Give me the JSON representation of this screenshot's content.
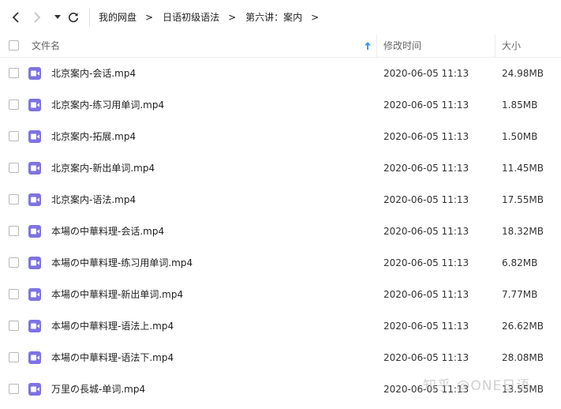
{
  "nav": {
    "breadcrumbs": [
      "我的网盘",
      "日语初级语法",
      "第六讲：案内"
    ],
    "separator": ">"
  },
  "header": {
    "col_name": "文件名",
    "col_date": "修改时间",
    "col_size": "大小",
    "sort_icon": "arrow-up-icon"
  },
  "files": [
    {
      "name": "北京案内-会话.mp4",
      "date": "2020-06-05 11:13",
      "size": "24.98MB"
    },
    {
      "name": "北京案内-练习用单词.mp4",
      "date": "2020-06-05 11:13",
      "size": "1.85MB"
    },
    {
      "name": "北京案内-拓展.mp4",
      "date": "2020-06-05 11:13",
      "size": "1.50MB"
    },
    {
      "name": "北京案内-新出单词.mp4",
      "date": "2020-06-05 11:13",
      "size": "11.45MB"
    },
    {
      "name": "北京案内-语法.mp4",
      "date": "2020-06-05 11:13",
      "size": "17.55MB"
    },
    {
      "name": "本場の中華料理-会话.mp4",
      "date": "2020-06-05 11:13",
      "size": "18.32MB"
    },
    {
      "name": "本場の中華料理-练习用单词.mp4",
      "date": "2020-06-05 11:13",
      "size": "6.82MB"
    },
    {
      "name": "本場の中華料理-新出单词.mp4",
      "date": "2020-06-05 11:13",
      "size": "7.77MB"
    },
    {
      "name": "本場の中華料理-语法上.mp4",
      "date": "2020-06-05 11:13",
      "size": "26.62MB"
    },
    {
      "name": "本場の中華料理-语法下.mp4",
      "date": "2020-06-05 11:13",
      "size": "28.08MB"
    },
    {
      "name": "万里の長城-单词.mp4",
      "date": "2020-06-05 11:13",
      "size": "13.55MB"
    }
  ],
  "watermark": "知乎 @ONE日语",
  "colors": {
    "file_icon": "#7e72e5",
    "sort_arrow": "#3b9cf0"
  }
}
